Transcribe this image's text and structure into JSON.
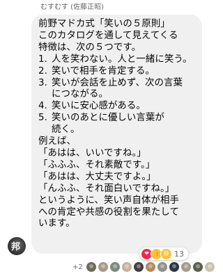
{
  "message": {
    "sender": "むすむす (佐藤正昭)",
    "avatar_char": "邦",
    "lines": [
      "前野マドカ式「笑いの５原則」",
      "このカタログを通して見えてくる",
      "特徴は、次の５つです。"
    ],
    "items": [
      {
        "num": "1.",
        "text": "人を笑わない。人と一緒に笑う。",
        "cont": []
      },
      {
        "num": "2.",
        "text": "笑いで相手を肯定する。",
        "cont": []
      },
      {
        "num": "3.",
        "text": "笑いが会話を止めず、次の言葉",
        "cont": [
          "につながる。"
        ]
      },
      {
        "num": "4.",
        "text": "笑いに安心感がある。",
        "cont": []
      },
      {
        "num": "5.",
        "text": "笑いのあとに優しい言葉が",
        "cont": [
          "続く。"
        ]
      }
    ],
    "tail": [
      "例えば、",
      "「あはは、いいですね。」",
      "「ふふふ、それ素敵です。」",
      "「あはは、大丈夫ですよ。」",
      "「んふふ、それ面白いですね。」",
      "というように、笑い声自体が相手",
      "への肯定や共感の役割を果たして",
      "います。"
    ]
  },
  "reactions": {
    "icons": [
      {
        "name": "heart-icon",
        "glyph": "❤",
        "color": "#f02849"
      },
      {
        "name": "thumbs-up-icon",
        "glyph": "👍",
        "color": "#f7c243"
      },
      {
        "name": "laughing-face-icon",
        "glyph": "😆",
        "color": "#f7c243"
      }
    ],
    "count": "13"
  },
  "seen_by": {
    "more_label": "+2",
    "avatars": [
      {
        "color": "#6b6b58"
      },
      {
        "color": "#a79a86"
      },
      {
        "color": "#7d8a7a"
      },
      {
        "color": "#c2b5a2"
      },
      {
        "color": "#3f3f3f"
      },
      {
        "color": "#b38a5b"
      },
      {
        "color": "#8f8f8f"
      },
      {
        "color": "#2e3444"
      },
      {
        "color": "#a19d89"
      },
      {
        "color": "#5a5f50"
      },
      {
        "color": "#c7c3b0"
      }
    ]
  }
}
